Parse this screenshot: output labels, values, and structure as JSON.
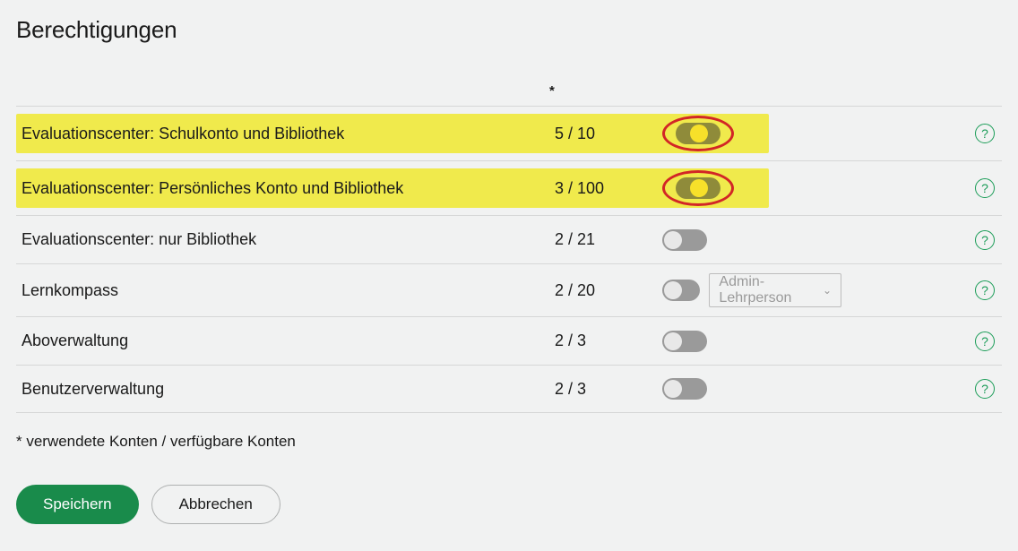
{
  "title": "Berechtigungen",
  "count_header_symbol": "*",
  "rows": [
    {
      "label": "Evaluationscenter: Schulkonto und Bibliothek",
      "count": "5 / 10",
      "toggle_on": true,
      "red_ring": true,
      "highlighted": true,
      "has_select": false
    },
    {
      "label": "Evaluationscenter: Persönliches Konto und Bibliothek",
      "count": "3 / 100",
      "toggle_on": true,
      "red_ring": true,
      "highlighted": true,
      "has_select": false
    },
    {
      "label": "Evaluationscenter: nur Bibliothek",
      "count": "2 / 21",
      "toggle_on": false,
      "red_ring": false,
      "highlighted": false,
      "has_select": false
    },
    {
      "label": "Lernkompass",
      "count": "2 / 20",
      "toggle_on": false,
      "red_ring": false,
      "highlighted": false,
      "has_select": true,
      "select_value": "Admin-Lehrperson"
    },
    {
      "label": "Aboverwaltung",
      "count": "2 / 3",
      "toggle_on": false,
      "red_ring": false,
      "highlighted": false,
      "has_select": false
    },
    {
      "label": "Benutzerverwaltung",
      "count": "2 / 3",
      "toggle_on": false,
      "red_ring": false,
      "highlighted": false,
      "has_select": false
    }
  ],
  "footnote": "* verwendete Konten / verfügbare Konten",
  "buttons": {
    "save": "Speichern",
    "cancel": "Abbrechen"
  },
  "help_glyph": "?"
}
